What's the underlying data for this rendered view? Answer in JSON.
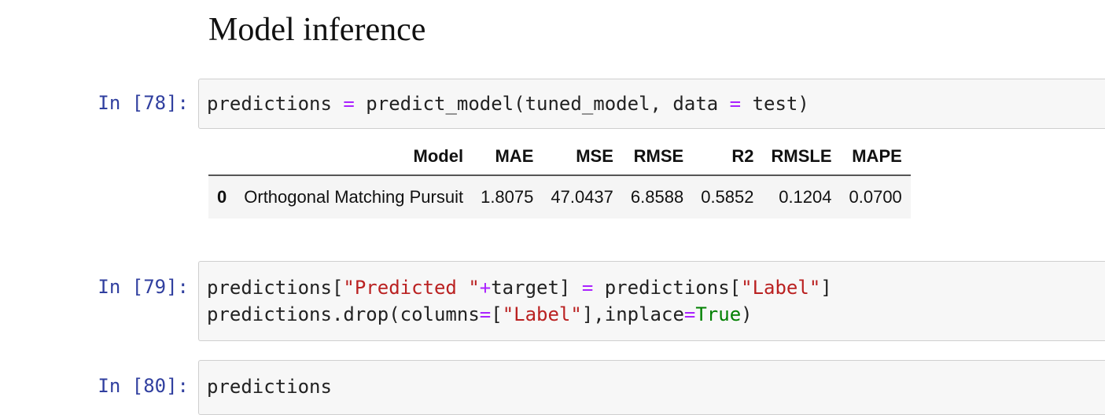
{
  "heading": "Model inference",
  "cells": [
    {
      "prompt": "In [78]:",
      "lines": [
        [
          {
            "t": "predictions ",
            "c": ""
          },
          {
            "t": "=",
            "c": "op"
          },
          {
            "t": " predict_model(tuned_model, data ",
            "c": ""
          },
          {
            "t": "=",
            "c": "op"
          },
          {
            "t": " test)",
            "c": ""
          }
        ]
      ]
    },
    {
      "prompt": "In [79]:",
      "lines": [
        [
          {
            "t": "predictions[",
            "c": ""
          },
          {
            "t": "\"Predicted \"",
            "c": "str"
          },
          {
            "t": "+",
            "c": "op"
          },
          {
            "t": "target] ",
            "c": ""
          },
          {
            "t": "=",
            "c": "op"
          },
          {
            "t": " predictions[",
            "c": ""
          },
          {
            "t": "\"Label\"",
            "c": "str"
          },
          {
            "t": "]",
            "c": ""
          }
        ],
        [
          {
            "t": "predictions.drop(columns",
            "c": ""
          },
          {
            "t": "=",
            "c": "op"
          },
          {
            "t": "[",
            "c": ""
          },
          {
            "t": "\"Label\"",
            "c": "str"
          },
          {
            "t": "],inplace",
            "c": ""
          },
          {
            "t": "=",
            "c": "op"
          },
          {
            "t": "True",
            "c": "kw"
          },
          {
            "t": ")",
            "c": ""
          }
        ]
      ]
    },
    {
      "prompt": "In [80]:",
      "lines": [
        [
          {
            "t": "predictions",
            "c": ""
          }
        ]
      ]
    }
  ],
  "output_table": {
    "columns": [
      "",
      "Model",
      "MAE",
      "MSE",
      "RMSE",
      "R2",
      "RMSLE",
      "MAPE"
    ],
    "rows": [
      [
        "0",
        "Orthogonal Matching Pursuit",
        "1.8075",
        "47.0437",
        "6.8588",
        "0.5852",
        "0.1204",
        "0.0700"
      ]
    ]
  }
}
